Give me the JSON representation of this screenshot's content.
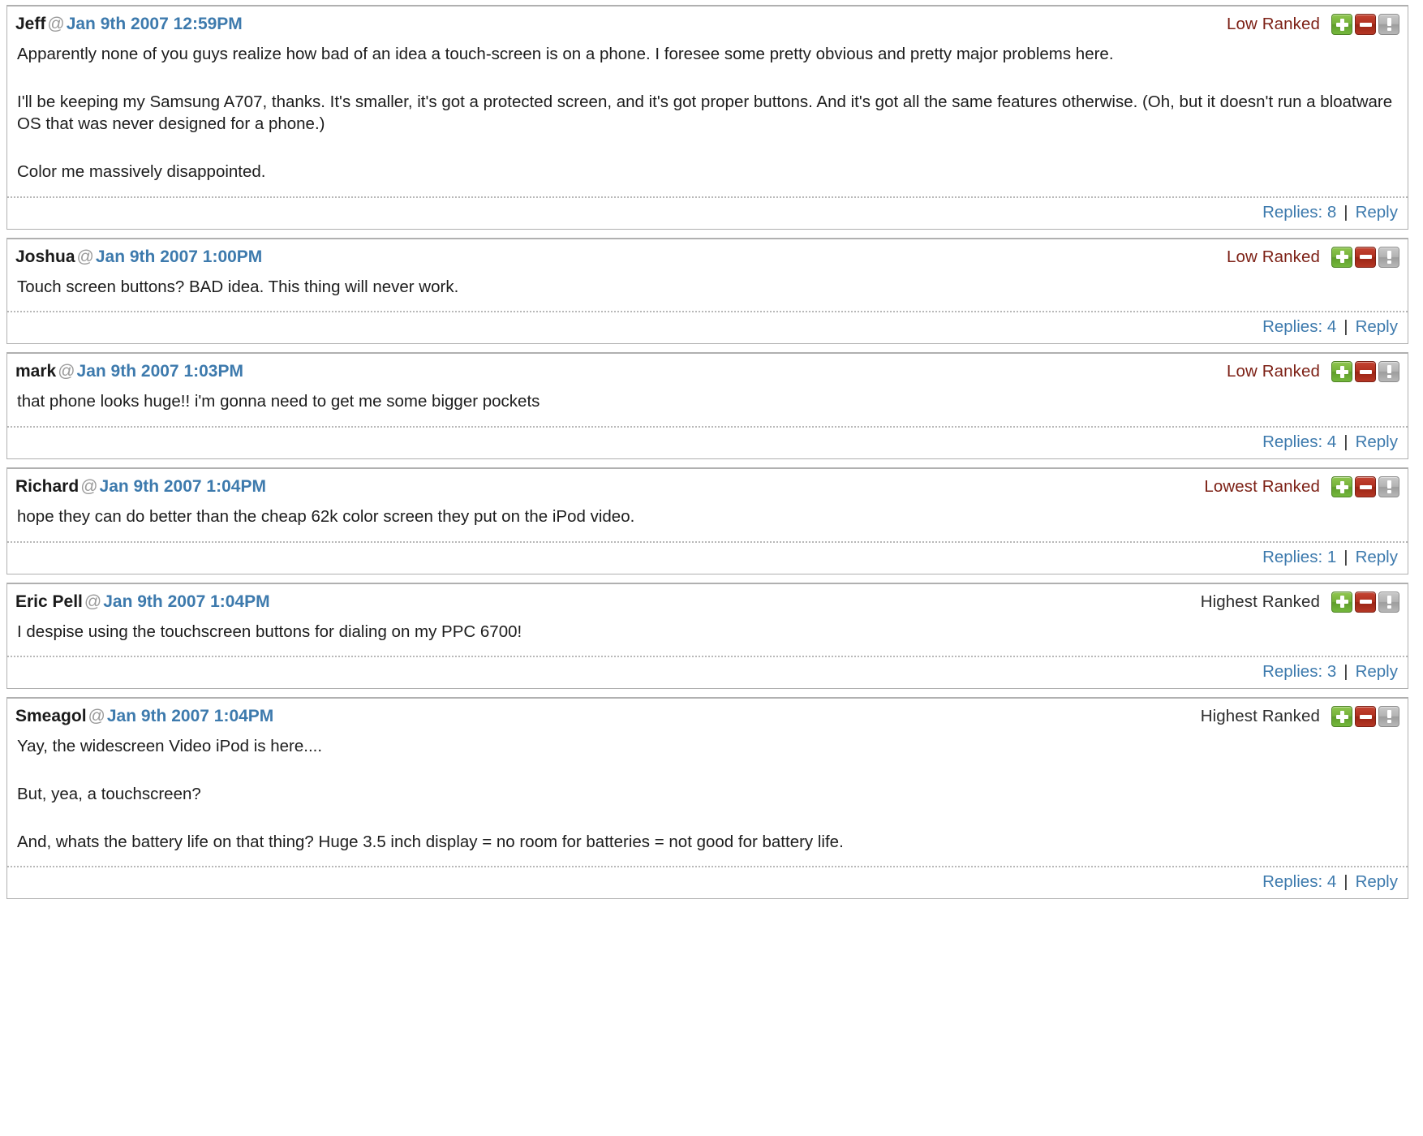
{
  "thread": {
    "vote_icons": {
      "up": "plus-icon",
      "down": "minus-icon",
      "flag": "exclamation-icon"
    },
    "colors": {
      "link": "#3d7aad",
      "rank_low": "#7d2116",
      "rank_high": "#2d2d2d",
      "vote_up": "#74b13a",
      "vote_down": "#b0301f",
      "vote_flag": "#b3b3b3",
      "border": "#b0b0b0"
    },
    "at_symbol": "@",
    "separator": "|",
    "reply_label": "Reply",
    "comments": [
      {
        "author": "Jeff",
        "timestamp": "Jan 9th 2007 12:59PM",
        "rank": "Low Ranked",
        "rank_style": "low",
        "paragraphs": [
          "Apparently none of you guys realize how bad of an idea a touch-screen is on a phone. I foresee some pretty obvious and pretty major problems here.",
          "I'll be keeping my Samsung A707, thanks. It's smaller, it's got a protected screen, and it's got proper buttons. And it's got all the same features otherwise. (Oh, but it doesn't run a bloatware OS that was never designed for a phone.)",
          "Color me massively disappointed."
        ],
        "replies_label": "Replies: 8"
      },
      {
        "author": "Joshua",
        "timestamp": "Jan 9th 2007 1:00PM",
        "rank": "Low Ranked",
        "rank_style": "low",
        "paragraphs": [
          "Touch screen buttons? BAD idea. This thing will never work."
        ],
        "replies_label": "Replies: 4"
      },
      {
        "author": "mark",
        "timestamp": "Jan 9th 2007 1:03PM",
        "rank": "Low Ranked",
        "rank_style": "low",
        "paragraphs": [
          "that phone looks huge!! i'm gonna need to get me some bigger pockets"
        ],
        "replies_label": "Replies: 4"
      },
      {
        "author": "Richard",
        "timestamp": "Jan 9th 2007 1:04PM",
        "rank": "Lowest Ranked",
        "rank_style": "lowest",
        "paragraphs": [
          "hope they can do better than the cheap 62k color screen they put on the iPod video."
        ],
        "replies_label": "Replies: 1"
      },
      {
        "author": "Eric Pell",
        "timestamp": "Jan 9th 2007 1:04PM",
        "rank": "Highest Ranked",
        "rank_style": "highest",
        "paragraphs": [
          "I despise using the touchscreen buttons for dialing on my PPC 6700!"
        ],
        "replies_label": "Replies: 3"
      },
      {
        "author": "Smeagol",
        "timestamp": "Jan 9th 2007 1:04PM",
        "rank": "Highest Ranked",
        "rank_style": "highest",
        "paragraphs": [
          "Yay, the widescreen Video iPod is here....",
          "But, yea, a touchscreen?",
          "And, whats the battery life on that thing? Huge 3.5 inch display = no room for batteries = not good for battery life."
        ],
        "replies_label": "Replies: 4"
      }
    ]
  }
}
